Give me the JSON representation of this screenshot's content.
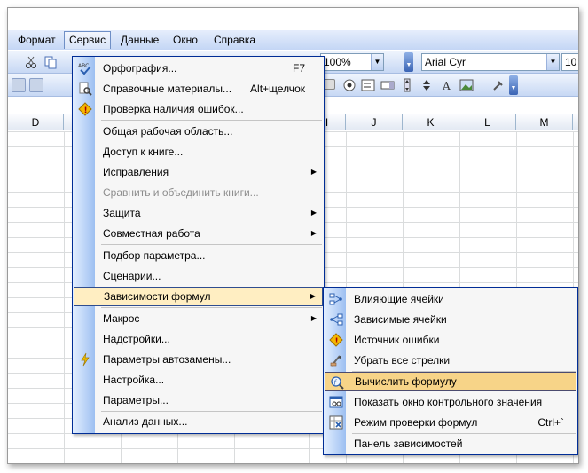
{
  "menubar": {
    "items": [
      {
        "label": "Формат"
      },
      {
        "label": "Сервис"
      },
      {
        "label": "Данные"
      },
      {
        "label": "Окно"
      },
      {
        "label": "Справка"
      }
    ]
  },
  "toolbar": {
    "zoom": "100%",
    "font": "Arial Cyr",
    "font_size": "10"
  },
  "columns": [
    "D",
    "I",
    "J",
    "K",
    "L",
    "M"
  ],
  "service_menu": {
    "items": [
      {
        "label": "Орфография...",
        "shortcut": "F7",
        "icon": "spellcheck-icon"
      },
      {
        "label": "Справочные материалы...",
        "shortcut": "Alt+щелчок",
        "icon": "research-icon"
      },
      {
        "label": "Проверка наличия ошибок...",
        "icon": "error-check-icon"
      },
      {
        "label": "Общая рабочая область..."
      },
      {
        "label": "Доступ к книге..."
      },
      {
        "label": "Исправления",
        "submenu": true
      },
      {
        "label": "Сравнить и объединить книги...",
        "disabled": true
      },
      {
        "label": "Защита",
        "submenu": true
      },
      {
        "label": "Совместная работа",
        "submenu": true
      },
      {
        "label": "Подбор параметра..."
      },
      {
        "label": "Сценарии..."
      },
      {
        "label": "Зависимости формул",
        "submenu": true,
        "highlighted": true
      },
      {
        "label": "Макрос",
        "submenu": true
      },
      {
        "label": "Надстройки..."
      },
      {
        "label": "Параметры автозамены...",
        "icon": "autocorrect-icon"
      },
      {
        "label": "Настройка..."
      },
      {
        "label": "Параметры..."
      },
      {
        "label": "Анализ данных..."
      }
    ]
  },
  "sub_menu": {
    "items": [
      {
        "label": "Влияющие ячейки",
        "icon": "trace-precedents-icon"
      },
      {
        "label": "Зависимые ячейки",
        "icon": "trace-dependents-icon"
      },
      {
        "label": "Источник ошибки",
        "icon": "trace-error-icon"
      },
      {
        "label": "Убрать все стрелки",
        "icon": "remove-arrows-icon"
      },
      {
        "label": "Вычислить формулу",
        "icon": "evaluate-formula-icon",
        "highlighted": true
      },
      {
        "label": "Показать окно контрольного значения",
        "icon": "watch-window-icon"
      },
      {
        "label": "Режим проверки формул",
        "shortcut": "Ctrl+`",
        "icon": "formula-audit-icon"
      },
      {
        "label": "Панель зависимостей"
      }
    ]
  },
  "colors": {
    "menu_border": "#002d96",
    "highlight": "#ffeec2",
    "highlight_sub": "#f7d488",
    "menubar": "#c4d6f5"
  }
}
